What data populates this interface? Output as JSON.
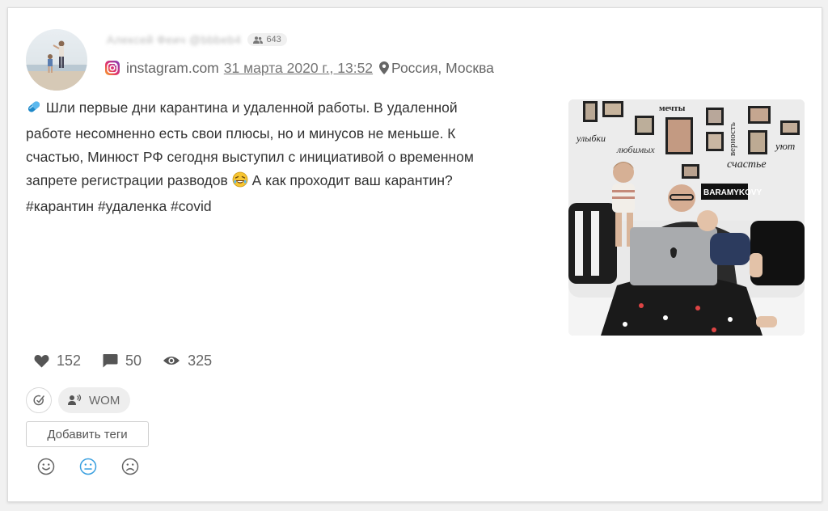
{
  "post": {
    "author_name": "Алексей Феич @bbbeb4",
    "followers": "643",
    "source": "instagram.com",
    "date": "31 марта 2020 г., 13:52",
    "location": "Россия, Москва",
    "text_lines": [
      "Шли первые дни карантина и удаленной работы. В удаленной",
      "работе несомненно есть свои плюсы, но и минусов не меньше. К",
      "счастью, Минюст РФ сегодня выступил с инициативой о временном",
      "запрете регистрации разводов",
      "А как проходит ваш карантин?",
      "#карантин #удаленка #covid"
    ],
    "photo_words": [
      "мечты",
      "улыбки",
      "любимых",
      "верность",
      "счастье",
      "уют",
      "BARAMYKOVY"
    ]
  },
  "stats": {
    "likes": "152",
    "comments": "50",
    "views": "325"
  },
  "tags": {
    "wom_label": "WOM",
    "add_tags_label": "Добавить теги"
  },
  "icons": {
    "instagram": "instagram-icon",
    "location": "location-pin-icon",
    "followers": "people-icon",
    "like": "heart-icon",
    "comment": "comment-icon",
    "views": "eye-icon",
    "edit": "edit-check-icon",
    "wom": "speaker-person-icon",
    "sentiment_positive": "smile-icon",
    "sentiment_neutral": "neutral-face-icon",
    "sentiment_negative": "sad-face-icon"
  },
  "colors": {
    "accent_neutral": "#3aa0e0",
    "text": "#333333",
    "muted": "#666666",
    "icon": "#555555"
  },
  "sentiment": {
    "selected": "neutral"
  }
}
